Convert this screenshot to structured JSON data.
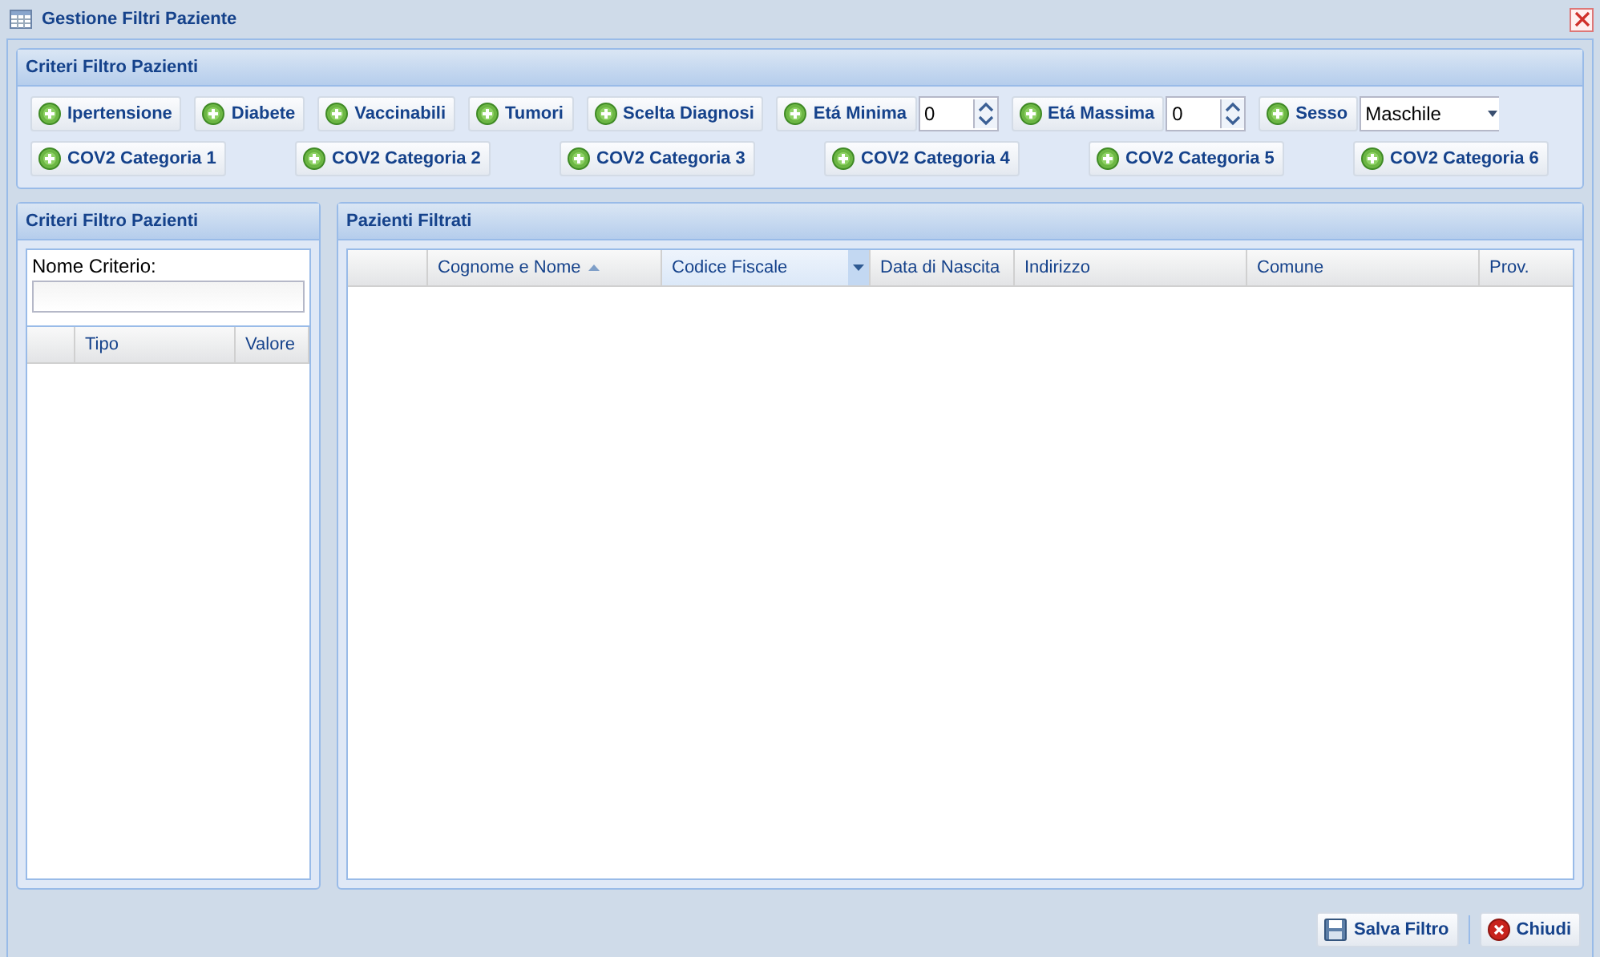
{
  "window": {
    "title": "Gestione Filtri Paziente"
  },
  "criteria_panel": {
    "title": "Criteri Filtro Pazienti",
    "row_1": [
      {
        "kind": "toggle",
        "label": "Ipertensione"
      },
      {
        "kind": "toggle",
        "label": "Diabete"
      },
      {
        "kind": "toggle",
        "label": "Vaccinabili"
      },
      {
        "kind": "toggle",
        "label": "Tumori"
      },
      {
        "kind": "toggle",
        "label": "Scelta Diagnosi"
      },
      {
        "kind": "number",
        "label": "Etá Minima",
        "value": "0"
      },
      {
        "kind": "number",
        "label": "Etá Massima",
        "value": "0"
      },
      {
        "kind": "select",
        "label": "Sesso",
        "value": "Maschile"
      }
    ],
    "row_2": [
      {
        "label": "COV2 Categoria 1"
      },
      {
        "label": "COV2 Categoria 2"
      },
      {
        "label": "COV2 Categoria 3"
      },
      {
        "label": "COV2 Categoria 4"
      },
      {
        "label": "COV2 Categoria 5"
      },
      {
        "label": "COV2 Categoria 6"
      }
    ]
  },
  "left_panel": {
    "title": "Criteri Filtro Pazienti",
    "field_label": "Nome Criterio:",
    "columns": [
      "Tipo",
      "Valore"
    ]
  },
  "right_panel": {
    "title": "Pazienti Filtrati",
    "columns": [
      {
        "label": "Cognome e Nome",
        "sorted_ascending": true,
        "highlighted": false
      },
      {
        "label": "Codice Fiscale",
        "sorted_ascending": false,
        "highlighted": true
      },
      {
        "label": "Data di Nascita",
        "sorted_ascending": false,
        "highlighted": false
      },
      {
        "label": "Indirizzo",
        "sorted_ascending": false,
        "highlighted": false
      },
      {
        "label": "Comune",
        "sorted_ascending": false,
        "highlighted": false
      },
      {
        "label": "Prov.",
        "sorted_ascending": false,
        "highlighted": false
      }
    ]
  },
  "buttons": [
    {
      "kind": "save",
      "label": "Salva Filtro"
    },
    {
      "kind": "close",
      "label": "Chiudi"
    }
  ]
}
